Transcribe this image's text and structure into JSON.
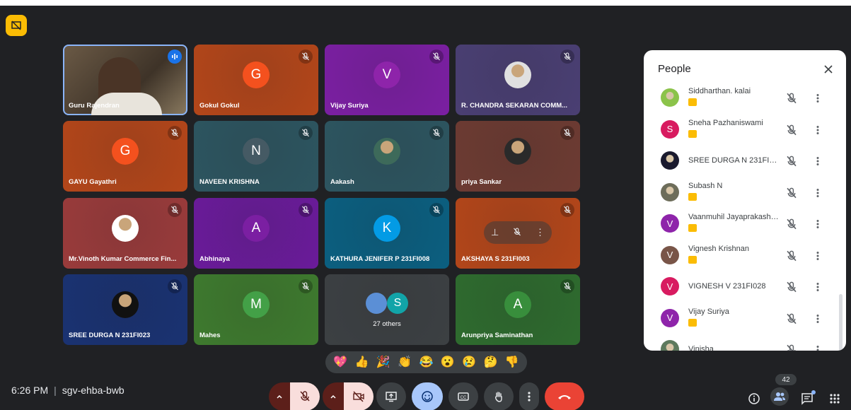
{
  "meeting": {
    "time": "6:26 PM",
    "code": "sgv-ehba-bwb"
  },
  "tiles": [
    {
      "name": "Guru Rajendran",
      "color": "#5a4a3a",
      "kind": "photo-full",
      "speaking": true
    },
    {
      "name": "Gokul Gokul",
      "color": "#b3461a",
      "kind": "letter",
      "letter": "G",
      "avatar_color": "#f4511e"
    },
    {
      "name": "Vijay Suriya",
      "color": "#7b1fa2",
      "kind": "letter",
      "letter": "V",
      "avatar_color": "#8e24aa"
    },
    {
      "name": "R. CHANDRA SEKARAN COMM...",
      "color": "#4a3f73",
      "kind": "photo",
      "avatar_color": "#e0e0e0"
    },
    {
      "name": "GAYU Gayathri",
      "color": "#b3461a",
      "kind": "letter",
      "letter": "G",
      "avatar_color": "#f4511e"
    },
    {
      "name": "NAVEEN KRISHNA",
      "color": "#2d5560",
      "kind": "letter",
      "letter": "N",
      "avatar_color": "#455a64"
    },
    {
      "name": "Aakash",
      "color": "#2d5560",
      "kind": "photo",
      "avatar_color": "#3d6a5a"
    },
    {
      "name": "priya Sankar",
      "color": "#6d3b32",
      "kind": "photo",
      "avatar_color": "#2a2a2a"
    },
    {
      "name": "Mr.Vinoth Kumar Commerce Fin...",
      "color": "#9a3b3b",
      "kind": "photo",
      "avatar_color": "#ffffff"
    },
    {
      "name": "Abhinaya",
      "color": "#6a1b9a",
      "kind": "letter",
      "letter": "A",
      "avatar_color": "#7b1fa2"
    },
    {
      "name": "KATHURA JENIFER P 231FI008",
      "color": "#0b5f80",
      "kind": "letter",
      "letter": "K",
      "avatar_color": "#039be5"
    },
    {
      "name": "AKSHAYA S 231FI003",
      "color": "#b3461a",
      "kind": "hover",
      "avatar_color": "#f4511e"
    },
    {
      "name": "SREE DURGA N 231FI023",
      "color": "#1a3272",
      "kind": "photo",
      "avatar_color": "#111111"
    },
    {
      "name": "Mahes",
      "color": "#3e7a2e",
      "kind": "letter",
      "letter": "M",
      "avatar_color": "#43a047"
    },
    {
      "name": "27 others",
      "color": "#3c4043",
      "kind": "others",
      "avatar_color": "#12a4a8",
      "letter": "S"
    },
    {
      "name": "Arunpriya Saminathan",
      "color": "#2e6b2e",
      "kind": "letter",
      "letter": "A",
      "avatar_color": "#388e3c"
    }
  ],
  "reactions": [
    "💖",
    "👍",
    "🎉",
    "👏",
    "😂",
    "😮",
    "😢",
    "🤔",
    "👎"
  ],
  "people_panel": {
    "title": "People",
    "count": "42",
    "participants": [
      {
        "name": "Siddharthan. kalai",
        "avatar": "photo",
        "color": "#8bc34a",
        "badge": true
      },
      {
        "name": "Sneha Pazhaniswami",
        "avatar": "letter",
        "letter": "S",
        "color": "#d81b60",
        "badge": true
      },
      {
        "name": "SREE DURGA N 231FI023",
        "avatar": "photo",
        "color": "#1a1a2e",
        "badge": false
      },
      {
        "name": "Subash N",
        "avatar": "photo",
        "color": "#6d6d5a",
        "badge": true
      },
      {
        "name": "Vaanmuhil Jayaprakash ...",
        "avatar": "letter",
        "letter": "V",
        "color": "#8e24aa",
        "badge": true
      },
      {
        "name": "Vignesh Krishnan",
        "avatar": "letter",
        "letter": "V",
        "color": "#795548",
        "badge": true
      },
      {
        "name": "VIGNESH V 231FI028",
        "avatar": "letter",
        "letter": "V",
        "color": "#d81b60",
        "badge": false
      },
      {
        "name": "Vijay Suriya",
        "avatar": "letter",
        "letter": "V",
        "color": "#8e24aa",
        "badge": true
      },
      {
        "name": "Vinisha",
        "avatar": "photo",
        "color": "#5d7a5d",
        "badge": false
      }
    ]
  }
}
